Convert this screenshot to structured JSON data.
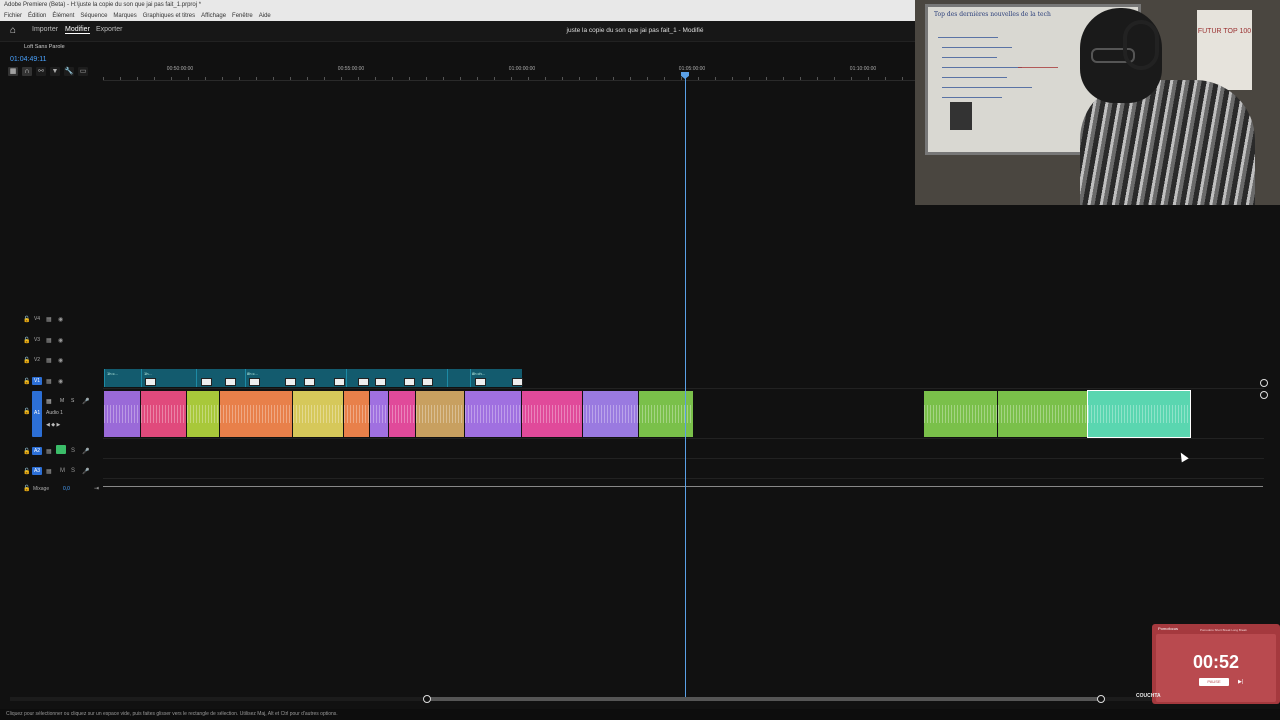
{
  "window": {
    "title": "Adobe Premiere (Beta) - H:\\juste la copie du son que jai pas fait_1.prproj *"
  },
  "menu": [
    "Fichier",
    "Édition",
    "Élément",
    "Séquence",
    "Marques",
    "Graphiques et titres",
    "Affichage",
    "Fenêtre",
    "Aide"
  ],
  "header": {
    "tabs": [
      "Importer",
      "Modifier",
      "Exporter"
    ],
    "active_tab": "Modifier",
    "document_title": "juste la copie du son que jai pas fait_1 - Modifié"
  },
  "sequence": {
    "name": "Loft Sans Parole",
    "timecode": "01:04:49:11"
  },
  "ruler": {
    "ticks": [
      "00:50:00:00",
      "00:55:00:00",
      "01:00:00:00",
      "01:05:00:00",
      "01:10:00:00"
    ]
  },
  "tracks": {
    "video": [
      {
        "id": "V4"
      },
      {
        "id": "V3"
      },
      {
        "id": "V2"
      },
      {
        "id": "V1"
      }
    ],
    "audio": [
      {
        "id": "A1",
        "name": "Audio 1"
      },
      {
        "id": "A2"
      },
      {
        "id": "A3"
      }
    ],
    "mix": {
      "label": "Mixage",
      "value": "0,0"
    }
  },
  "v1_clip_labels": [
    "1h c...",
    "1h...",
    "8h c...",
    "8h ch..."
  ],
  "audio_clip_colors": [
    "#9a6ad8",
    "#e04a7c",
    "#a8c83a",
    "#e8804a",
    "#d6c85a",
    "#e8804a",
    "#a070e0",
    "#e04a9a",
    "#c8a060",
    "#a070e0",
    "#e04a9a",
    "#9a7ae0",
    "#7ac04a",
    "#7ac04a",
    "#7ac04a",
    "#5ad6b0"
  ],
  "status": {
    "text": "Cliquez pour sélectionner ou cliquez sur un espace vide, puis faites glisser vers le rectangle de sélection. Utilisez Maj, Alt et Ctrl pour d'autres options."
  },
  "webcam": {
    "whiteboard_title": "Top des dernières nouvelles de la tech",
    "poster_text": "FUTUR TOP 100"
  },
  "timer_widget": {
    "brand": "Pomofocus",
    "tabs": "Pomodoro  Short Break  Long Break",
    "time": "00:52",
    "start": "PAUSE",
    "footer": "#1"
  },
  "overlay_label": "COUCHTA"
}
